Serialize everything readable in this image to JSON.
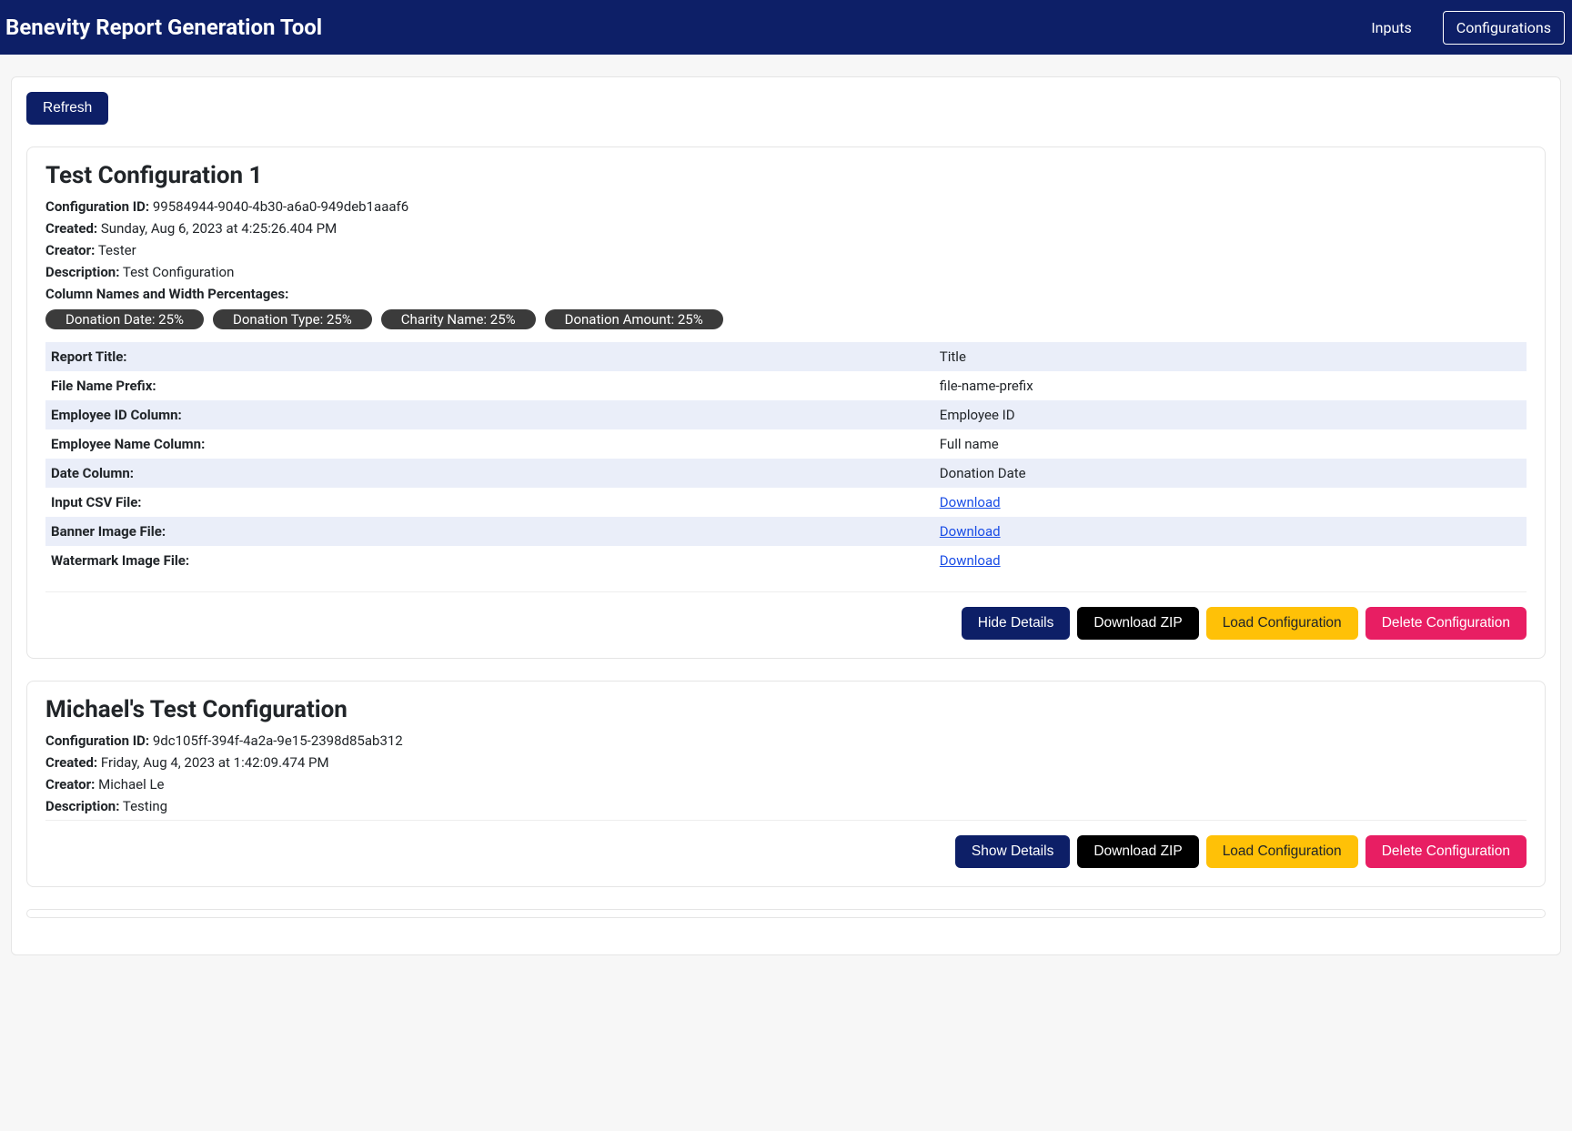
{
  "header": {
    "title": "Benevity Report Generation Tool",
    "nav_inputs": "Inputs",
    "nav_configs": "Configurations"
  },
  "actions": {
    "refresh": "Refresh",
    "hide_details": "Hide Details",
    "show_details": "Show Details",
    "download_zip": "Download ZIP",
    "load_config": "Load Configuration",
    "delete_config": "Delete Configuration"
  },
  "labels": {
    "config_id": "Configuration ID:",
    "created": "Created:",
    "creator": "Creator:",
    "description": "Description:",
    "cols_heading": "Column Names and Width Percentages:",
    "report_title": "Report Title:",
    "file_prefix": "File Name Prefix:",
    "emp_id_col": "Employee ID Column:",
    "emp_name_col": "Employee Name Column:",
    "date_col": "Date Column:",
    "input_csv": "Input CSV File:",
    "banner_img": "Banner Image File:",
    "watermark_img": "Watermark Image File:",
    "download": "Download"
  },
  "configs": [
    {
      "title": "Test Configuration 1",
      "id": "99584944-9040-4b30-a6a0-949deb1aaaf6",
      "created": "Sunday, Aug 6, 2023 at 4:25:26.404 PM",
      "creator": "Tester",
      "description": "Test Configuration",
      "columns": [
        "Donation Date: 25%",
        "Donation Type: 25%",
        "Charity Name: 25%",
        "Donation Amount: 25%"
      ],
      "details": {
        "report_title": "Title",
        "file_prefix": "file-name-prefix",
        "emp_id_col": "Employee ID",
        "emp_name_col": "Full name",
        "date_col": "Donation Date"
      },
      "expanded": true
    },
    {
      "title": "Michael's Test Configuration",
      "id": "9dc105ff-394f-4a2a-9e15-2398d85ab312",
      "created": "Friday, Aug 4, 2023 at 1:42:09.474 PM",
      "creator": "Michael Le",
      "description": "Testing",
      "expanded": false
    }
  ]
}
